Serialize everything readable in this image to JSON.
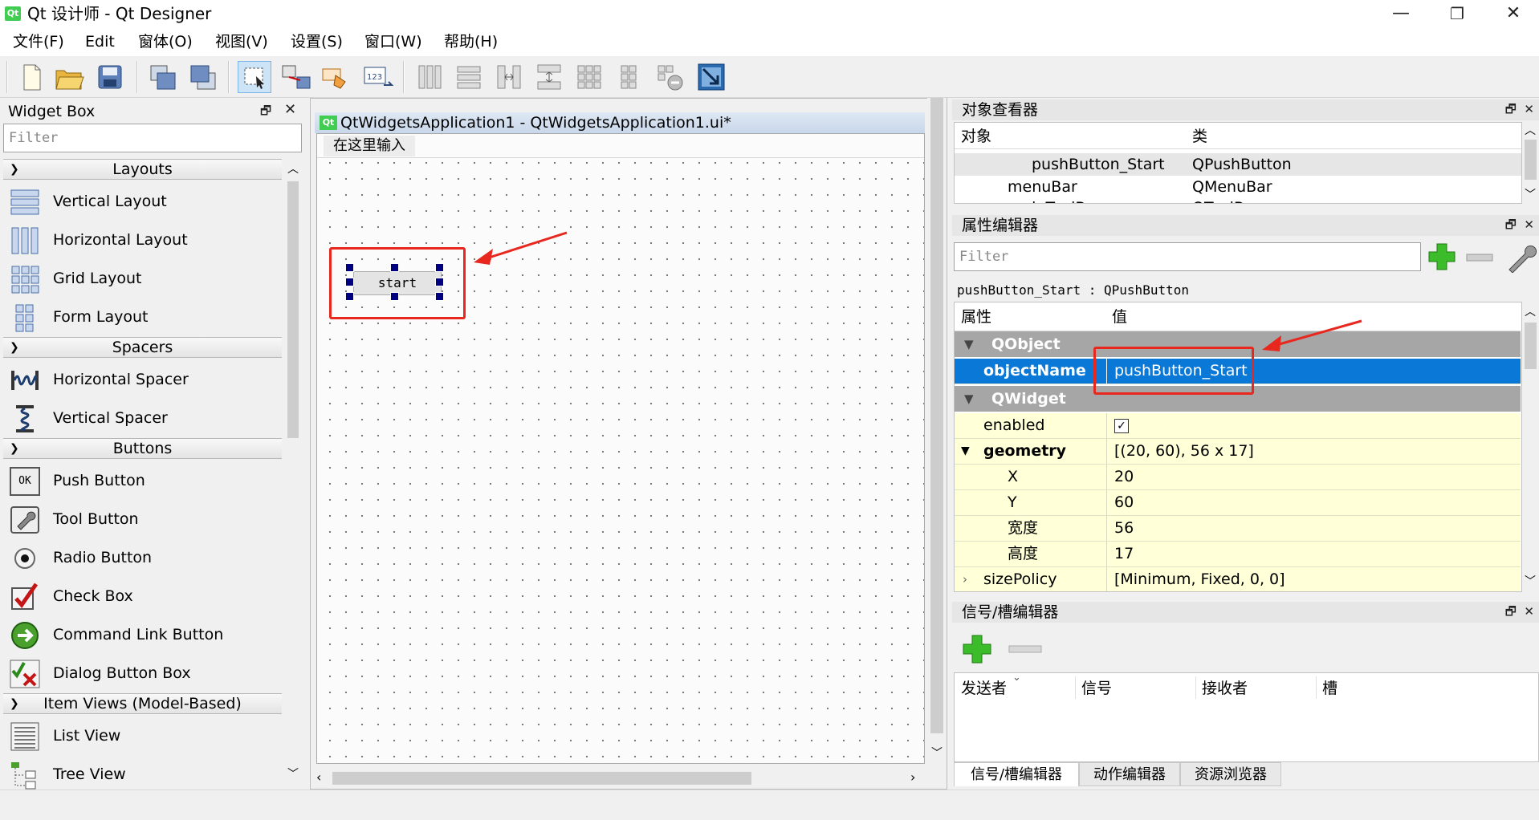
{
  "window": {
    "title": "Qt 设计师 - Qt Designer",
    "app_icon_text": "Qt",
    "minimize_glyph": "—",
    "restore_glyph": "❐",
    "close_glyph": "✕"
  },
  "menubar": {
    "items": [
      "文件(F)",
      "Edit",
      "窗体(O)",
      "视图(V)",
      "设置(S)",
      "窗口(W)",
      "帮助(H)"
    ]
  },
  "toolbar": {
    "buttons": [
      "new-icon",
      "open-icon",
      "save-icon",
      "send-to-back-icon",
      "bring-to-front-icon",
      "edit-widgets-icon",
      "edit-signals-slots-icon",
      "edit-buddies-icon",
      "edit-tab-order-icon",
      "layout-horizontal-icon",
      "layout-vertical-icon",
      "layout-horizontal-splitter-icon",
      "layout-vertical-splitter-icon",
      "layout-grid-icon",
      "layout-form-icon",
      "break-layout-icon",
      "adjust-size-icon"
    ]
  },
  "widget_box": {
    "title": "Widget Box",
    "filter_placeholder": "Filter",
    "categories": [
      {
        "label": "Layouts",
        "items": [
          "Vertical Layout",
          "Horizontal Layout",
          "Grid Layout",
          "Form Layout"
        ]
      },
      {
        "label": "Spacers",
        "items": [
          "Horizontal Spacer",
          "Vertical Spacer"
        ]
      },
      {
        "label": "Buttons",
        "items": [
          "Push Button",
          "Tool Button",
          "Radio Button",
          "Check Box",
          "Command Link Button",
          "Dialog Button Box"
        ]
      },
      {
        "label": "Item Views (Model-Based)",
        "items": [
          "List View",
          "Tree View"
        ]
      }
    ],
    "item_icons": {
      "Vertical Layout": "vertical-layout-icon",
      "Horizontal Layout": "horizontal-layout-icon",
      "Grid Layout": "grid-layout-icon",
      "Form Layout": "form-layout-icon",
      "Horizontal Spacer": "horizontal-spacer-icon",
      "Vertical Spacer": "vertical-spacer-icon",
      "Push Button": "push-button-icon",
      "Tool Button": "tool-button-icon",
      "Radio Button": "radio-button-icon",
      "Check Box": "check-box-icon",
      "Command Link Button": "command-link-button-icon",
      "Dialog Button Box": "dialog-button-box-icon",
      "List View": "list-view-icon",
      "Tree View": "tree-view-icon"
    },
    "push_button_icon_text": "OK"
  },
  "form": {
    "subwindow_title": "QtWidgetsApplication1 - QtWidgetsApplication1.ui*",
    "subwindow_icon_text": "Qt",
    "menu_placeholder": "在这里输入",
    "button_text": "start"
  },
  "object_inspector": {
    "title": "对象查看器",
    "col_object": "对象",
    "col_class": "类",
    "rows": [
      {
        "object": "pushButton_Start",
        "class": "QPushButton",
        "selected": true,
        "indent": 2
      },
      {
        "object": "menuBar",
        "class": "QMenuBar",
        "selected": false,
        "indent": 1
      },
      {
        "object": "mainToolBar",
        "class": "QToolBar",
        "selected": false,
        "indent": 1
      }
    ]
  },
  "property_editor": {
    "title": "属性编辑器",
    "filter_placeholder": "Filter",
    "object_info": "pushButton_Start : QPushButton",
    "col_property": "属性",
    "col_value": "值",
    "rows": [
      {
        "type": "group",
        "label": "QObject"
      },
      {
        "type": "prop",
        "key": "objectName",
        "value": "pushButton_Start",
        "bold": true,
        "selected": true,
        "indent": 0
      },
      {
        "type": "group",
        "label": "QWidget"
      },
      {
        "type": "prop",
        "key": "enabled",
        "value": "",
        "checkbox": true,
        "bold": false,
        "indent": 0
      },
      {
        "type": "prop",
        "key": "geometry",
        "value": "[(20, 60), 56 x 17]",
        "bold": true,
        "expanded": true,
        "indent": 0
      },
      {
        "type": "prop",
        "key": "X",
        "value": "20",
        "bold": false,
        "indent": 1
      },
      {
        "type": "prop",
        "key": "Y",
        "value": "60",
        "bold": false,
        "indent": 1
      },
      {
        "type": "prop",
        "key": "宽度",
        "value": "56",
        "bold": false,
        "indent": 1
      },
      {
        "type": "prop",
        "key": "高度",
        "value": "17",
        "bold": false,
        "indent": 1
      },
      {
        "type": "prop",
        "key": "sizePolicy",
        "value": "[Minimum, Fixed, 0, 0]",
        "bold": false,
        "collapsed": true,
        "indent": 0
      }
    ]
  },
  "signal_slot_editor": {
    "title": "信号/槽编辑器",
    "col_sender": "发送者",
    "col_signal": "信号",
    "col_receiver": "接收者",
    "col_slot": "槽"
  },
  "bottom_tabs": [
    "信号/槽编辑器",
    "动作编辑器",
    "资源浏览器"
  ],
  "colors": {
    "selection": "#0a78d7",
    "annotation_red": "#e8271f",
    "property_row_bg": "#ffffd8",
    "group_row_bg": "#a6a6a6",
    "qt_green": "#41cd52"
  }
}
